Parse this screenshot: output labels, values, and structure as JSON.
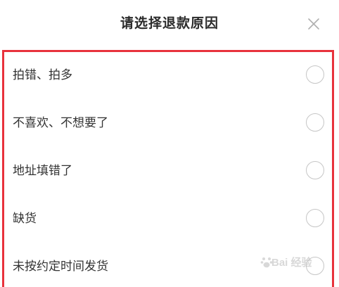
{
  "header": {
    "title": "请选择退款原因",
    "close_icon": "close-icon"
  },
  "options": [
    {
      "label": "拍错、拍多",
      "selected": false
    },
    {
      "label": "不喜欢、不想要了",
      "selected": false
    },
    {
      "label": "地址填错了",
      "selected": false
    },
    {
      "label": "缺货",
      "selected": false
    },
    {
      "label": "未按约定时间发货",
      "selected": false
    }
  ],
  "watermark": {
    "text": "Bai 经验",
    "icon": "paw-icon"
  },
  "colors": {
    "highlight": "#e8323c",
    "radio_border": "#c6c6c6",
    "text": "#333333",
    "close": "#b0b0b0"
  }
}
